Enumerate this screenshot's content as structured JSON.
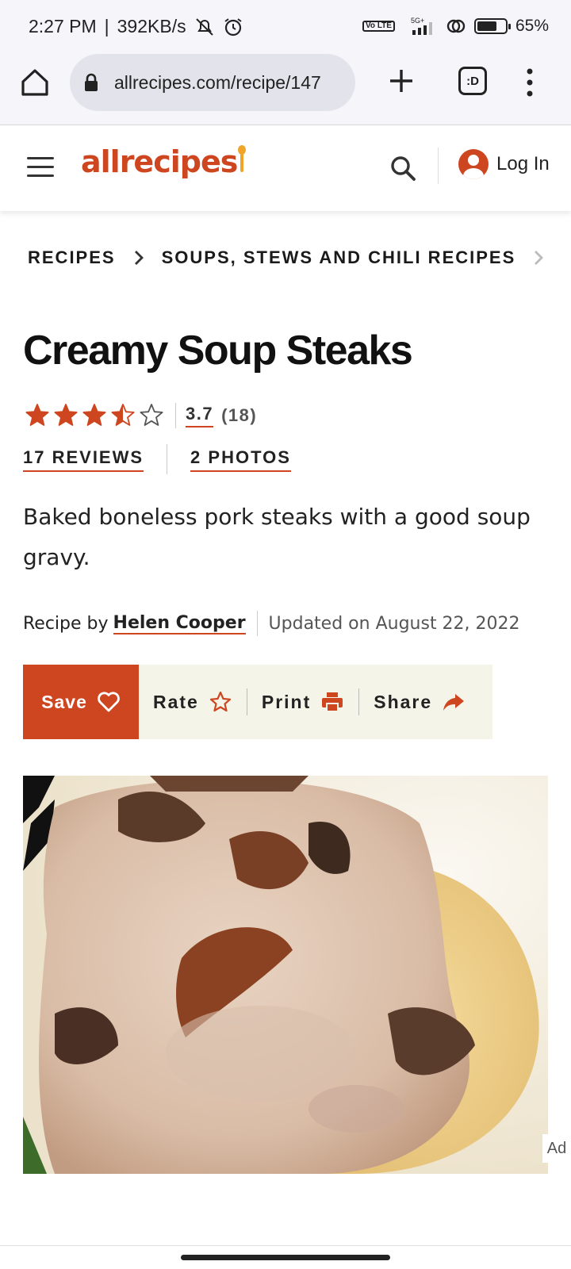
{
  "status_bar": {
    "time": "2:27 PM",
    "speed": "392KB/s",
    "network": "5G+",
    "volte": "Vo LTE",
    "battery_percent": 65,
    "battery_label": "65%"
  },
  "browser": {
    "url": "allrecipes.com/recipe/147",
    "tabs_label": ":D"
  },
  "header": {
    "logo": "allrecipes",
    "login_label": "Log In"
  },
  "breadcrumb": {
    "items": [
      "RECIPES",
      "SOUPS, STEWS AND CHILI RECIPES"
    ]
  },
  "recipe": {
    "title": "Creamy Soup Steaks",
    "rating_value": "3.7",
    "rating_count": "(18)",
    "rating_stars": 3.5,
    "reviews_label": "17 REVIEWS",
    "photos_label": "2 PHOTOS",
    "description": "Baked boneless pork steaks with a good soup gravy.",
    "byline_prefix": "Recipe by",
    "author": "Helen Cooper",
    "updated": "Updated on August 22, 2022"
  },
  "actions": {
    "save": "Save",
    "rate": "Rate",
    "print": "Print",
    "share": "Share"
  },
  "ad_label": "Ad",
  "colors": {
    "brand": "#ce4620",
    "action_bar_bg": "#f4f4e9",
    "logo_spoon": "#f0a52a"
  }
}
